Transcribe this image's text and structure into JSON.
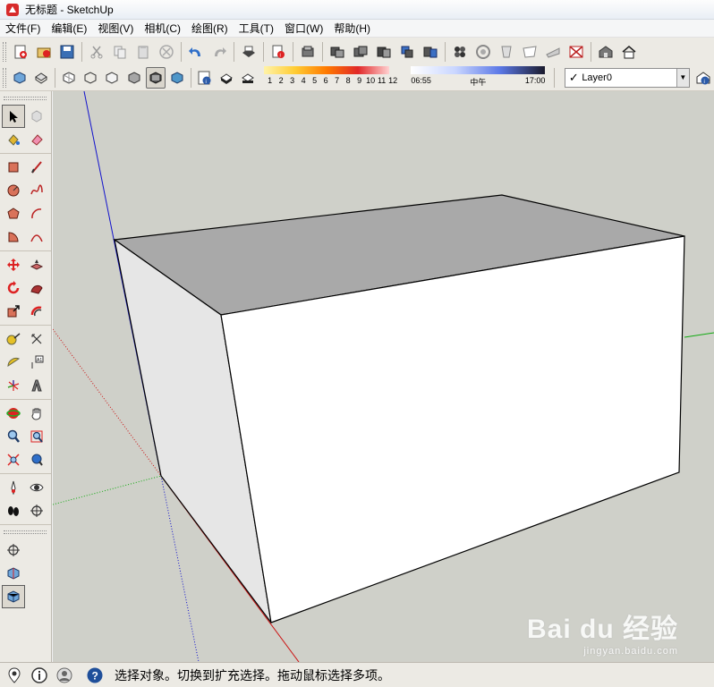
{
  "window": {
    "title": "无标题 - SketchUp"
  },
  "menu": {
    "items": [
      "文件(F)",
      "编辑(E)",
      "视图(V)",
      "相机(C)",
      "绘图(R)",
      "工具(T)",
      "窗口(W)",
      "帮助(H)"
    ]
  },
  "toolbar_standard": {
    "icons": [
      "new-file-icon",
      "open-file-icon",
      "save-icon",
      "cut-icon",
      "copy-icon",
      "paste-icon",
      "erase-selection-icon",
      "undo-icon",
      "redo-icon",
      "print-icon",
      "model-info-icon",
      "components-icon",
      "group-icon",
      "solid-union-icon",
      "solid-intersect-icon",
      "solid-subtract-icon",
      "sandbox-icon",
      "smoove-icon",
      "stamp-icon",
      "drape-icon",
      "add-detail-icon",
      "flip-edge-icon",
      "warehouse-icon",
      "home-icon"
    ]
  },
  "toolbar_views": {
    "style_icons": [
      "xray-icon",
      "back-edges-icon",
      "wireframe-icon",
      "hidden-line-icon",
      "shaded-icon",
      "shaded-textures-icon",
      "monochrome-icon"
    ],
    "shadow_info_icon": "shadow-settings-icon",
    "month_labels": [
      "1",
      "2",
      "3",
      "4",
      "5",
      "6",
      "7",
      "8",
      "9",
      "10",
      "11",
      "12"
    ],
    "time_start": "06:55",
    "time_mid": "中午",
    "time_end": "17:00",
    "layer": {
      "name": "Layer0",
      "checked": "✓"
    }
  },
  "sidebar": {
    "groups": [
      [
        "select-icon",
        "make-component-icon",
        "paint-bucket-icon",
        "eraser-icon"
      ],
      [
        "rectangle-icon",
        "line-icon",
        "circle-icon",
        "freehand-icon",
        "polygon-icon",
        "arc-icon",
        "pie-icon",
        "two-point-arc-icon"
      ],
      [
        "move-icon",
        "push-pull-icon",
        "rotate-icon",
        "follow-me-icon",
        "scale-icon",
        "offset-icon"
      ],
      [
        "tape-measure-icon",
        "dimension-icon",
        "protractor-icon",
        "text-icon",
        "axes-icon",
        "3d-text-icon"
      ],
      [
        "orbit-icon",
        "pan-icon",
        "zoom-icon",
        "zoom-window-icon",
        "zoom-extents-icon",
        "previous-view-icon"
      ],
      [
        "position-camera-icon",
        "look-around-icon",
        "walk-icon",
        "section-plane-icon"
      ],
      [
        "section-plane-2-icon",
        "section-display-icon",
        "section-cuts-icon"
      ]
    ]
  },
  "status": {
    "message": "选择对象。切换到扩充选择。拖动鼠标选择多项。"
  },
  "watermark": {
    "main": "Bai du 经验",
    "sub": "jingyan.baidu.com"
  },
  "colors": {
    "viewport_bg": "#cfd0c9",
    "box_top": "#a9a9a9",
    "box_front": "#ffffff",
    "box_side": "#e6e6e6",
    "axis_red": "#cc1111",
    "axis_green": "#11aa11",
    "axis_blue": "#1111cc"
  }
}
